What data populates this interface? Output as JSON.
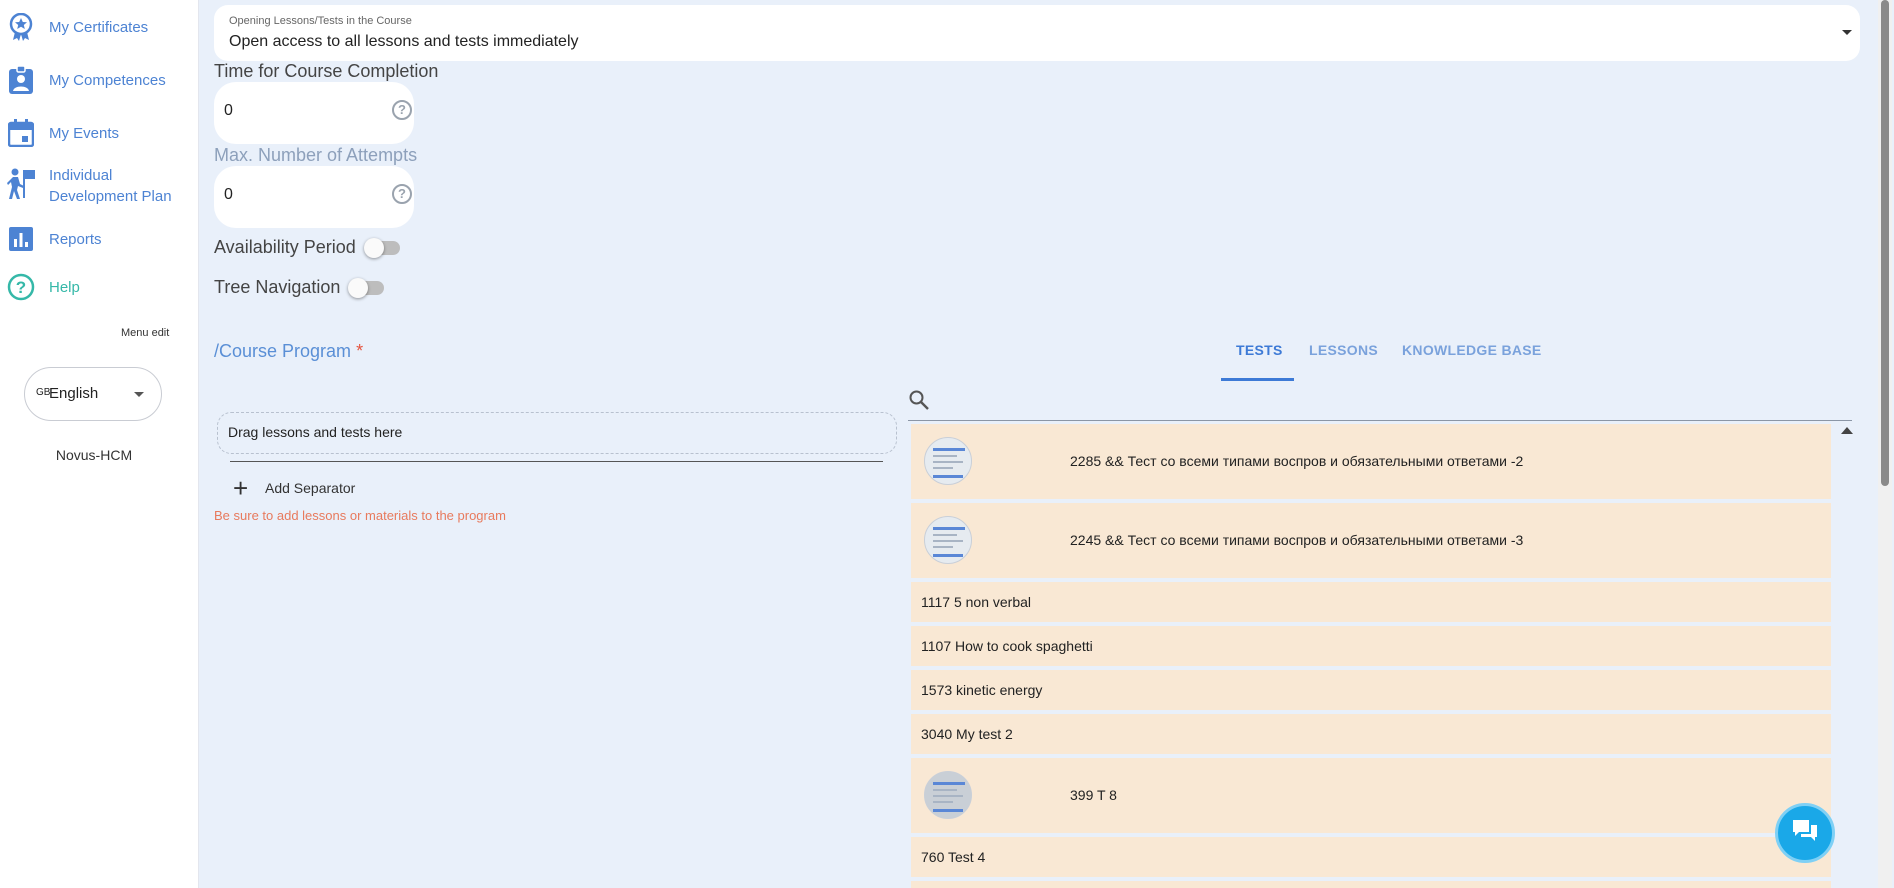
{
  "sidebar": {
    "items": [
      {
        "label": "My Certificates",
        "icon": "certificate-icon"
      },
      {
        "label": "My Competences",
        "icon": "badge-icon"
      },
      {
        "label": "My Events",
        "icon": "calendar-icon"
      },
      {
        "label": "Individual\nDevelopment Plan",
        "icon": "development-plan-icon"
      },
      {
        "label": "Reports",
        "icon": "bar-chart-icon"
      },
      {
        "label": "Help",
        "icon": "help-icon"
      }
    ],
    "menu_edit": "Menu edit",
    "language": {
      "flag": "GB",
      "value": "English"
    },
    "brand": "Novus-HCM"
  },
  "form": {
    "opening_select": {
      "label": "Opening Lessons/Tests in the Course",
      "value": "Open access to all lessons and tests immediately"
    },
    "time_label": "Time for Course Completion",
    "time_value": "0",
    "attempts_label": "Max. Number of Attempts",
    "attempts_value": "0",
    "availability_label": "Availability Period",
    "tree_label": "Tree Navigation",
    "program_title": "/Course Program",
    "required_mark": "*",
    "dropzone": "Drag lessons and tests here",
    "add_separator": "Add Separator",
    "warning": "Be sure to add lessons or materials to the program"
  },
  "tabs": [
    {
      "label": "TESTS",
      "active": true
    },
    {
      "label": "LESSONS",
      "active": false
    },
    {
      "label": "KNOWLEDGE BASE",
      "active": false
    }
  ],
  "list": [
    {
      "text": "2285 && Тест со всеми типами воспров и обязательными ответами -2",
      "thumb": true
    },
    {
      "text": "2245 && Тест со всеми типами воспров и обязательными ответами -3",
      "thumb": true
    },
    {
      "text": "1117 5 non verbal",
      "thumb": false
    },
    {
      "text": "1107 How to cook spaghetti",
      "thumb": false
    },
    {
      "text": "1573 kinetic energy",
      "thumb": false
    },
    {
      "text": "3040 My test 2",
      "thumb": false
    },
    {
      "text": "399 T 8",
      "thumb": true
    },
    {
      "text": "760 Test 4",
      "thumb": false
    }
  ],
  "colors": {
    "accent": "#3d7ad6",
    "row_bg": "#f9e8d4",
    "main_bg": "#e9f0fa",
    "chat": "#1aa8e8",
    "warning": "#e87a5d"
  }
}
